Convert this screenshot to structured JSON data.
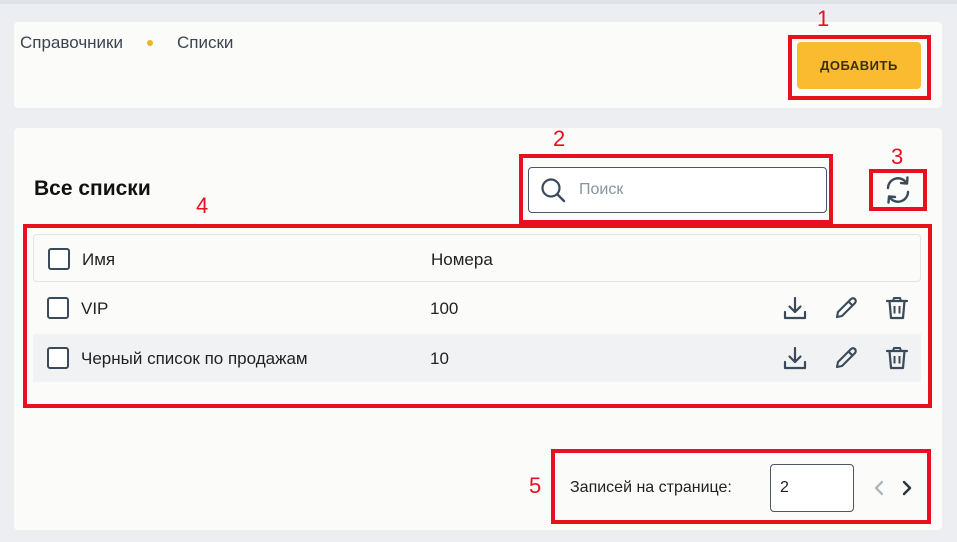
{
  "breadcrumb": {
    "items": [
      "Справочники",
      "Списки"
    ]
  },
  "toolbar": {
    "add_label": "ДОБАВИТЬ"
  },
  "section": {
    "title": "Все списки"
  },
  "search": {
    "placeholder": "Поиск",
    "value": ""
  },
  "table": {
    "columns": [
      "Имя",
      "Номера"
    ],
    "rows": [
      {
        "name": "VIP",
        "numbers": "100"
      },
      {
        "name": "Черный список по продажам",
        "numbers": "10"
      }
    ]
  },
  "pagination": {
    "label": "Записей на странице:",
    "per_page": "2"
  },
  "annotations": [
    "1",
    "2",
    "3",
    "4",
    "5"
  ],
  "colors": {
    "accent": "#fbbb30",
    "annotation": "#e8101f",
    "icon": "#3b4a5a"
  },
  "icons": [
    "search-icon",
    "refresh-icon",
    "download-icon",
    "pencil-icon",
    "trash-icon",
    "chevron-left-icon",
    "chevron-right-icon"
  ]
}
